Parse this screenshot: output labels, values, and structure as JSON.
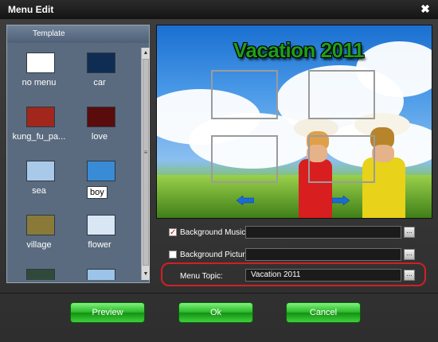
{
  "window": {
    "title": "Menu Edit",
    "close_glyph": "✖"
  },
  "template_panel": {
    "header": "Template",
    "items": [
      {
        "label": "no menu",
        "thumb_color": "#ffffff",
        "selected": false
      },
      {
        "label": "car",
        "thumb_color": "#0f2d52",
        "selected": false
      },
      {
        "label": "kung_fu_pa...",
        "thumb_color": "#a1261b",
        "selected": false
      },
      {
        "label": "love",
        "thumb_color": "#5a0b0b",
        "selected": false
      },
      {
        "label": "sea",
        "thumb_color": "#a9c9e8",
        "selected": false
      },
      {
        "label": "boy",
        "thumb_color": "#3a8bd6",
        "selected": true
      },
      {
        "label": "village",
        "thumb_color": "#8a7a3a",
        "selected": false
      },
      {
        "label": "flower",
        "thumb_color": "#d9e7f5",
        "selected": false
      },
      {
        "label": "",
        "thumb_color": "#2f4a3a",
        "selected": false
      },
      {
        "label": "",
        "thumb_color": "#9bc4e8",
        "selected": false
      }
    ],
    "scroll_up_glyph": "▲",
    "scroll_down_glyph": "▼",
    "scroll_grip_glyph": "≡"
  },
  "preview": {
    "title": "Vacation 2011",
    "arrow_left_icon": "left-arrow-icon",
    "arrow_right_icon": "right-arrow-icon"
  },
  "options": {
    "background_music": {
      "label": "Background Music:",
      "checked": true,
      "value": "",
      "browse": "..."
    },
    "background_picture": {
      "label": "Background Picture:",
      "checked": false,
      "value": "",
      "browse": "..."
    },
    "menu_topic": {
      "label": "Menu Topic:",
      "value": "Vacation 2011",
      "browse": "..."
    }
  },
  "buttons": {
    "preview": "Preview",
    "ok": "Ok",
    "cancel": "Cancel"
  },
  "colors": {
    "accent_green": "#2bb82a",
    "highlight_red": "#d21f26"
  }
}
